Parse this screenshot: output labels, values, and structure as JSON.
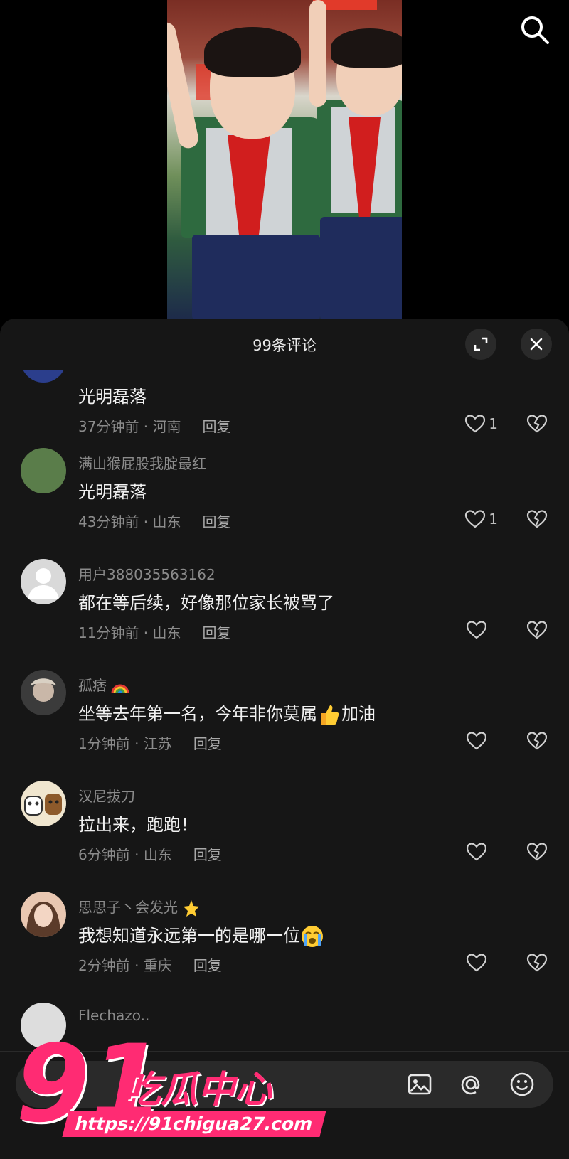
{
  "header": {
    "title": "99条评论"
  },
  "comments": [
    {
      "username": "",
      "text": "光明磊落",
      "time": "37分钟前",
      "location": "河南",
      "reply": "回复",
      "likes": "1",
      "avatar": "#2b3e8c"
    },
    {
      "username": "满山猴屁股我腚最红",
      "text": "光明磊落",
      "time": "43分钟前",
      "location": "山东",
      "reply": "回复",
      "likes": "1",
      "avatar": "#5a7d4a"
    },
    {
      "username": "用户388035563162",
      "text": "都在等后续，好像那位家长被骂了",
      "time": "11分钟前",
      "location": "山东",
      "reply": "回复",
      "likes": "",
      "avatar": "#d9d9d9"
    },
    {
      "username": "孤痞",
      "username_emoji": "rainbow",
      "text": "坐等去年第一名，今年非你莫属",
      "text_emoji": "thumbs-up",
      "text_after": "加油",
      "time": "1分钟前",
      "location": "江苏",
      "reply": "回复",
      "likes": "",
      "avatar": "#3b3b3b"
    },
    {
      "username": "汉尼拔刀",
      "text": "拉出来，跑跑！",
      "time": "6分钟前",
      "location": "山东",
      "reply": "回复",
      "likes": "",
      "avatar": "#f0e6cf"
    },
    {
      "username": "思思子丶会发光",
      "username_emoji": "star",
      "text": "我想知道永远第一的是哪一位",
      "text_emoji": "crying-face",
      "time": "2分钟前",
      "location": "重庆",
      "reply": "回复",
      "likes": "",
      "avatar": "#e9c7b1"
    },
    {
      "username": "Flechazo..",
      "text": "",
      "time": "",
      "location": "",
      "reply": "",
      "likes": "",
      "avatar": "#ddd"
    }
  ],
  "input": {
    "placeholder": ""
  },
  "watermark": {
    "number": "91",
    "text": "吃瓜中心",
    "url": "https://91chigua27.com"
  },
  "colors": {
    "sheet": "#161616",
    "watermark": "#ff2b73"
  },
  "icons": [
    "search-icon",
    "expand-icon",
    "close-icon",
    "heart-icon",
    "broken-heart-icon",
    "image-icon",
    "at-icon",
    "emoji-icon"
  ]
}
